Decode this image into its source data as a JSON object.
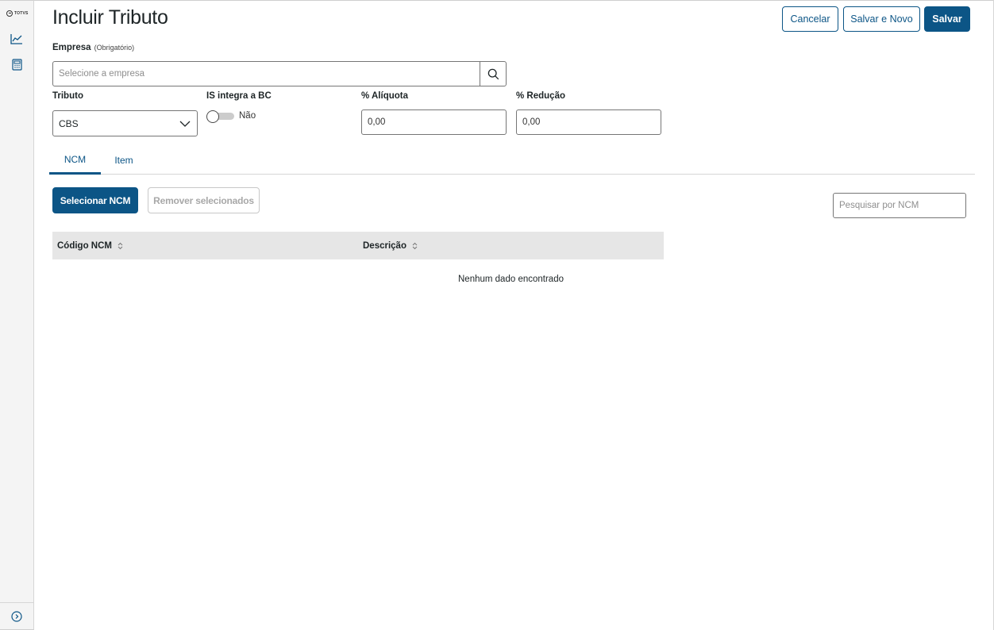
{
  "rail": {
    "brand": "TOTVS",
    "items": [
      {
        "icon": "chart-line-icon"
      },
      {
        "icon": "calculator-icon"
      }
    ],
    "expand_icon": "chevron-right-circle-icon"
  },
  "header": {
    "title": "Incluir Tributo",
    "cancel_label": "Cancelar",
    "save_new_label": "Salvar e Novo",
    "save_label": "Salvar"
  },
  "form": {
    "empresa": {
      "label": "Empresa",
      "optional": "(Obrigatório)",
      "placeholder": "Selecione a empresa",
      "value": ""
    },
    "tributo": {
      "label": "Tributo",
      "value": "CBS"
    },
    "is_integra": {
      "label": "IS integra a BC",
      "state_label": "Não",
      "checked": false
    },
    "aliquota": {
      "label": "% Alíquota",
      "value": "0,00"
    },
    "reducao": {
      "label": "% Redução",
      "value": "0,00"
    }
  },
  "tabs": [
    {
      "label": "NCM",
      "active": true
    },
    {
      "label": "Item",
      "active": false
    }
  ],
  "actions": {
    "select_label": "Selecionar NCM",
    "remove_label": "Remover selecionados"
  },
  "search": {
    "placeholder": "Pesquisar por NCM",
    "value": ""
  },
  "table": {
    "columns": [
      "Código NCM",
      "Descrição"
    ],
    "rows": [],
    "empty_text": "Nenhum dado encontrado"
  },
  "colors": {
    "primary": "#0c5586",
    "border": "#767676",
    "header_bg": "#e6e6e6",
    "disabled_text": "#a8a8a8"
  }
}
